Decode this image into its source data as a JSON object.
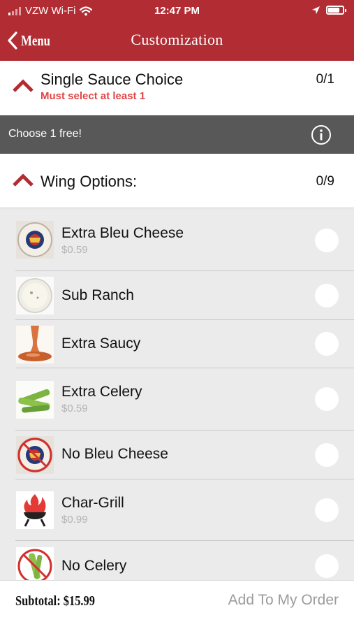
{
  "status_bar": {
    "carrier": "VZW Wi-Fi",
    "time": "12:47 PM",
    "icons": [
      "signal-icon",
      "wifi-icon",
      "location-arrow-icon",
      "battery-icon"
    ]
  },
  "nav": {
    "back_label": "Menu",
    "title": "Customization"
  },
  "colors": {
    "brand": "#b12d33",
    "warning": "#e04646",
    "banner": "#585858"
  },
  "sauce_section": {
    "title": "Single Sauce Choice",
    "requirement": "Must select at least 1",
    "count": "0/1"
  },
  "promo": {
    "text": "Choose 1 free!"
  },
  "wing_section": {
    "title": "Wing Options:",
    "count": "0/9"
  },
  "options": [
    {
      "name": "Extra Bleu Cheese",
      "price": "$0.59",
      "image": "bleu-cheese-cup"
    },
    {
      "name": "Sub Ranch",
      "price": "",
      "image": "ranch-cup"
    },
    {
      "name": "Extra Saucy",
      "price": "",
      "image": "sauce-pour"
    },
    {
      "name": "Extra Celery",
      "price": "$0.59",
      "image": "celery-sticks"
    },
    {
      "name": "No Bleu Cheese",
      "price": "",
      "image": "no-bleu-cheese"
    },
    {
      "name": "Char-Grill",
      "price": "$0.99",
      "image": "grill-flame"
    },
    {
      "name": "No Celery",
      "price": "",
      "image": "no-celery"
    }
  ],
  "footer": {
    "subtotal": "Subtotal: $15.99",
    "add_button": "Add To My Order"
  }
}
